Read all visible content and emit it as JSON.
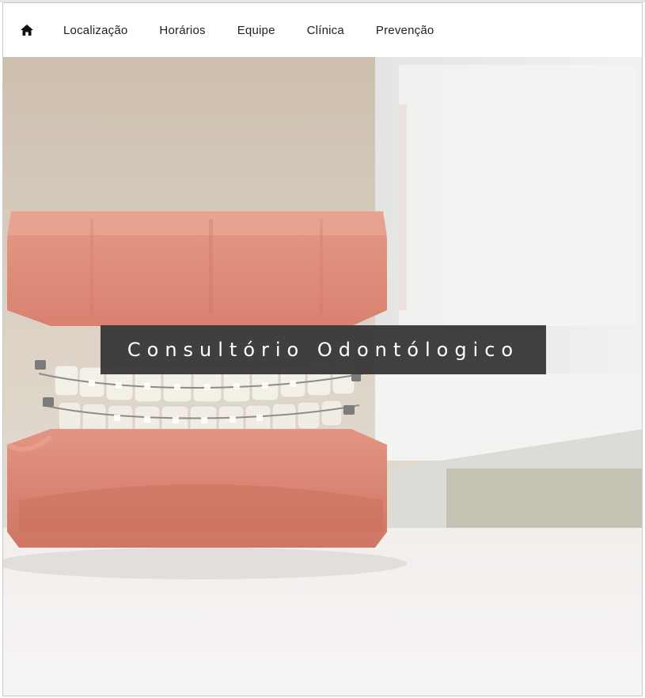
{
  "nav": {
    "home_icon": "home-icon",
    "items": [
      {
        "label": "Localização"
      },
      {
        "label": "Horários"
      },
      {
        "label": "Equipe"
      },
      {
        "label": "Clínica"
      },
      {
        "label": "Prevenção"
      }
    ]
  },
  "hero": {
    "title": "Consultório Odontólogico",
    "image": "dental-model-with-braces"
  },
  "colors": {
    "overlay": "#373737",
    "gum": "#e08a7a",
    "teeth": "#f4f1ea"
  }
}
